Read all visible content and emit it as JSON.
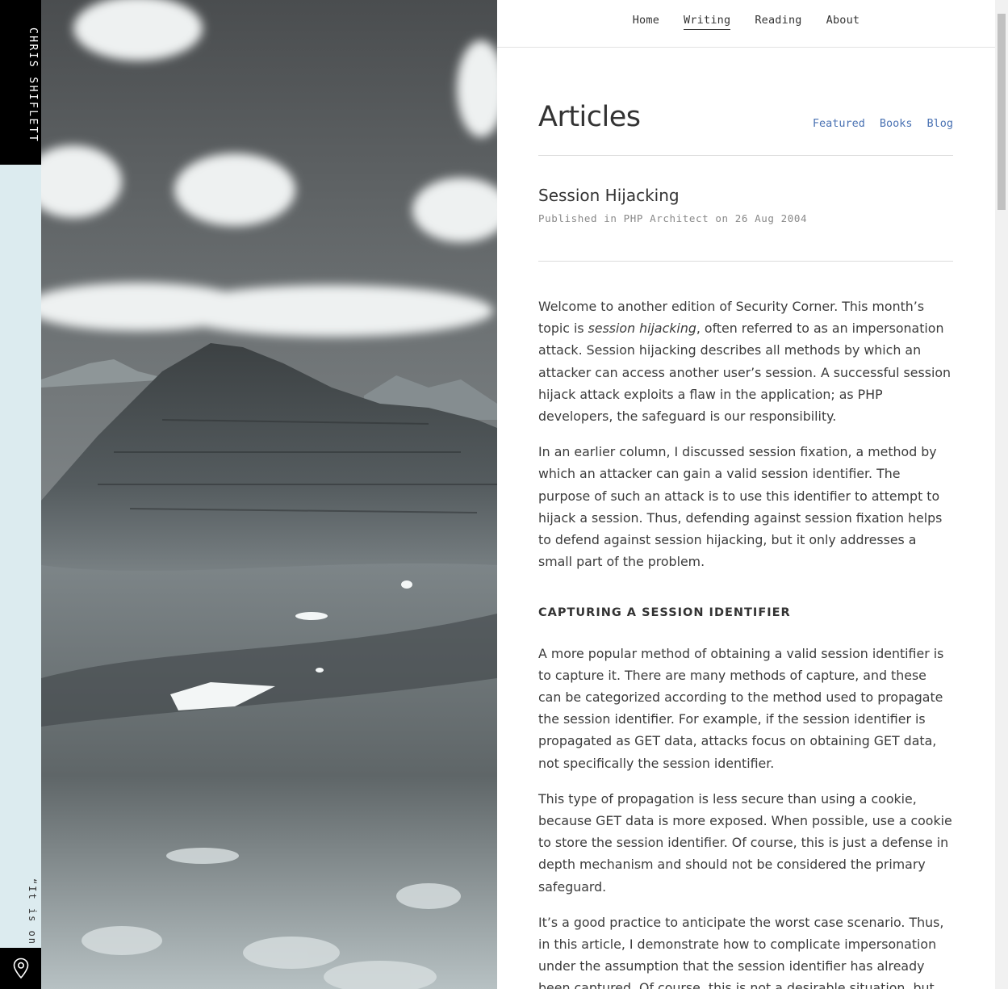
{
  "rail": {
    "brand": "CHRIS SHIFLETT",
    "quote": "“It is on",
    "location_icon": "map-pin-icon"
  },
  "nav": {
    "items": [
      {
        "label": "Home",
        "active": false
      },
      {
        "label": "Writing",
        "active": true
      },
      {
        "label": "Reading",
        "active": false
      },
      {
        "label": "About",
        "active": false
      }
    ]
  },
  "section": {
    "title": "Articles",
    "filters": [
      "Featured",
      "Books",
      "Blog"
    ]
  },
  "article": {
    "title": "Session Hijacking",
    "meta": "Published in PHP Architect on 26 Aug 2004",
    "p1_before": "Welcome to another edition of Security Corner. This month’s topic is ",
    "p1_em": "session hijacking",
    "p1_after": ", often referred to as an impersonation attack. Session hijacking describes all methods by which an attacker can access another user’s session. A successful session hijack attack exploits a flaw in the application; as PHP developers, the safeguard is our responsibility.",
    "p2": "In an earlier column, I discussed session fixation, a method by which an attacker can gain a valid session identifier. The purpose of such an attack is to use this identifier to attempt to hijack a session. Thus, defending against session fixation helps to defend against session hijacking, but it only addresses a small part of the problem.",
    "h3": "CAPTURING A SESSION IDENTIFIER",
    "p3": "A more popular method of obtaining a valid session identifier is to capture it. There are many methods of capture, and these can be categorized according to the method used to propagate the session identifier. For example, if the session identifier is propagated as GET data, attacks focus on obtaining GET data, not specifically the session identifier.",
    "p4": "This type of propagation is less secure than using a cookie, because GET data is more exposed. When possible, use a cookie to store the session identifier. Of course, this is just a defense in depth mechanism and should not be considered the primary safeguard.",
    "p5": "It’s a good practice to anticipate the worst case scenario. Thus, in this article, I demonstrate how to complicate impersonation under the assumption that the session identifier has already been captured. Of course, this is not a desirable situation, but"
  },
  "colors": {
    "rail_bg": "#dcebef",
    "brand_bg": "#000000",
    "link": "#4a72b3",
    "text": "#3b3b3b"
  }
}
